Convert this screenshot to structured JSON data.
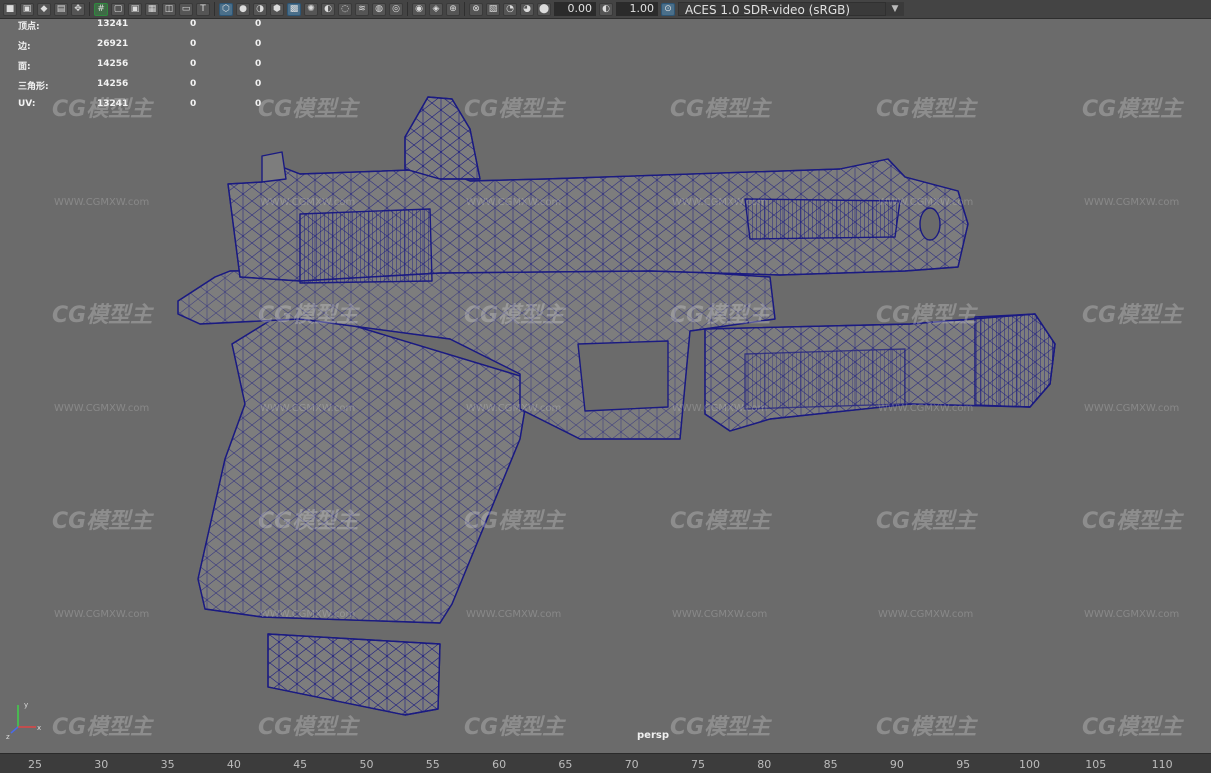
{
  "toolbar": {
    "icons": [
      "camera-icon",
      "camera-attr-icon",
      "bookmark-icon",
      "image-plane-icon",
      "move-icon",
      "grid-icon",
      "film-gate-icon",
      "resolution-gate-icon",
      "gate-mask-icon",
      "field-chart-icon",
      "safe-action-icon",
      "safe-title-icon",
      "wireframe-icon",
      "smooth-shade-icon",
      "default-material-icon",
      "wireframe-on-shaded-icon",
      "textured-icon",
      "lights-icon",
      "shadows-icon",
      "screen-ao-icon",
      "motion-blur-icon",
      "aa-icon",
      "depth-of-field-icon",
      "isolate-icon",
      "xray-icon",
      "xray-joints-icon",
      "xray-components-icon",
      "backface-icon",
      "exposure-icon",
      "gamma-icon",
      "color-mgmt-icon"
    ],
    "exposure_value": "0.00",
    "gamma_value": "1.00",
    "color_management": "ACES 1.0 SDR-video (sRGB)"
  },
  "hud": {
    "rows": [
      {
        "label": "顶点:",
        "v1": "13241",
        "v2": "0",
        "v3": "0"
      },
      {
        "label": "边:",
        "v1": "26921",
        "v2": "0",
        "v3": "0"
      },
      {
        "label": "面:",
        "v1": "14256",
        "v2": "0",
        "v3": "0"
      },
      {
        "label": "三角形:",
        "v1": "14256",
        "v2": "0",
        "v3": "0"
      },
      {
        "label": "UV:",
        "v1": "13241",
        "v2": "0",
        "v3": "0"
      }
    ]
  },
  "camera_label": "persp",
  "axis": {
    "x": "x",
    "y": "y",
    "z": "z"
  },
  "watermark": {
    "logo": "CG模型主",
    "url": "WWW.CGMXW.com"
  },
  "ruler_ticks": [
    "25",
    "30",
    "35",
    "40",
    "45",
    "50",
    "55",
    "60",
    "65",
    "70",
    "75",
    "80",
    "85",
    "90",
    "95",
    "100",
    "105",
    "110"
  ],
  "colors": {
    "viewport_bg": "#6b6b6b",
    "wireframe": "#1a1a82",
    "mesh_fill": "#7d7d7d"
  }
}
